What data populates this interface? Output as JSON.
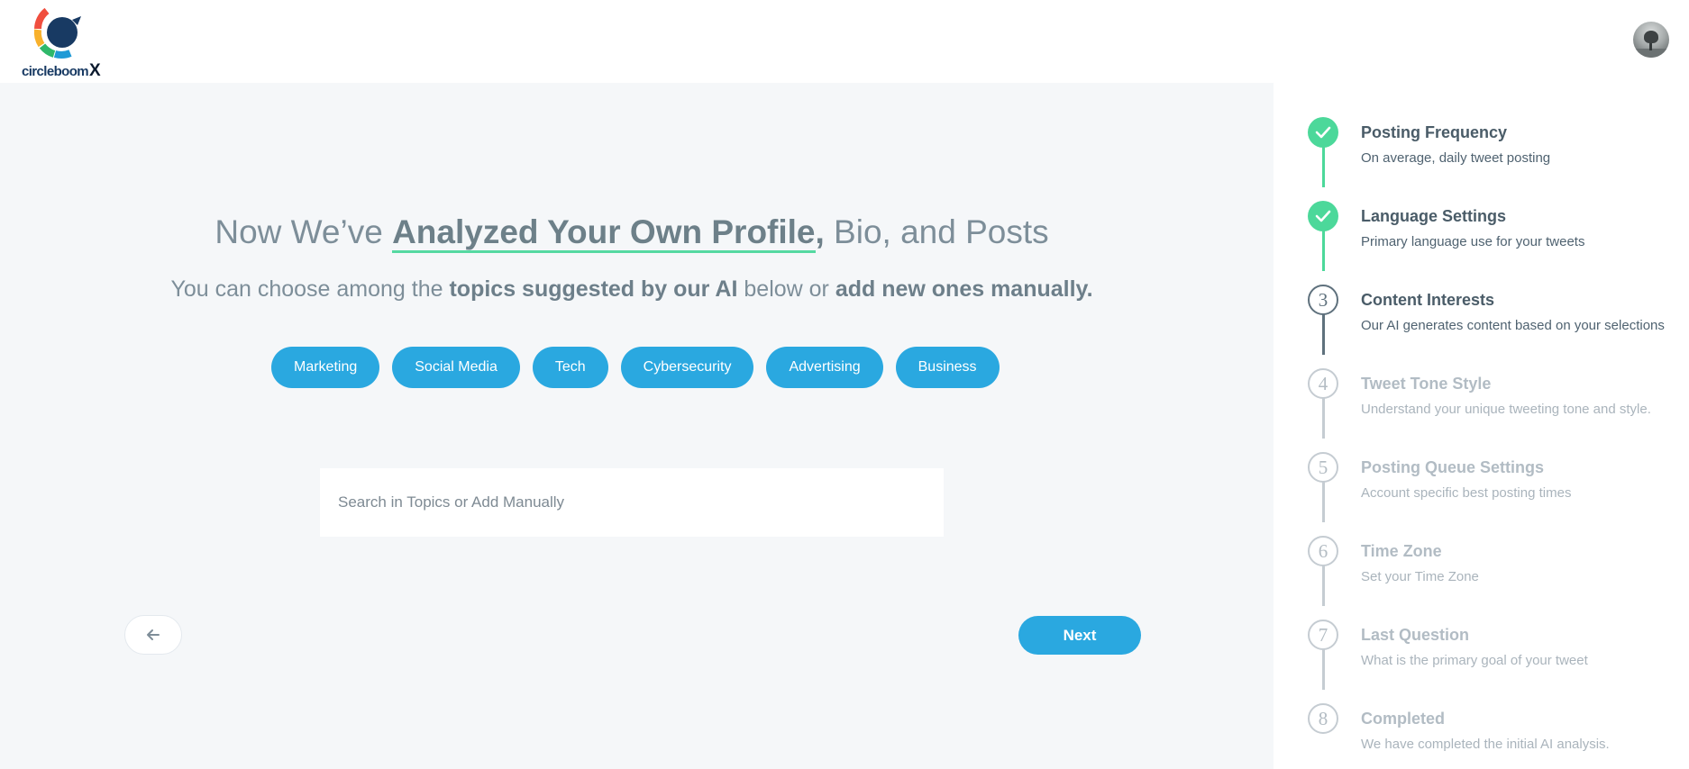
{
  "brand": {
    "logo_text": "circleboom",
    "logo_suffix": "X",
    "colors": {
      "primary": "#2aa8e0",
      "success": "#4cd89a",
      "navy": "#183a63"
    }
  },
  "user": {
    "avatar_icon": "user-avatar"
  },
  "main": {
    "headline_pre": "Now We’ve ",
    "headline_highlight": "Analyzed Your Own Profile",
    "headline_comma": ",",
    "headline_post": " Bio, and Posts",
    "sub_pre": "You can choose among the ",
    "sub_bold1": "topics suggested by our AI",
    "sub_mid": " below or ",
    "sub_bold2": "add new ones manually.",
    "topics": [
      "Marketing",
      "Social Media",
      "Tech",
      "Cybersecurity",
      "Advertising",
      "Business"
    ],
    "search_placeholder": "Search in Topics or Add Manually",
    "back_icon": "arrow-left-icon",
    "next_label": "Next"
  },
  "steps": [
    {
      "number": "1",
      "title": "Posting Frequency",
      "desc": "On average, daily tweet posting",
      "status": "done"
    },
    {
      "number": "2",
      "title": "Language Settings",
      "desc": "Primary language use for your tweets",
      "status": "done"
    },
    {
      "number": "3",
      "title": "Content Interests",
      "desc": "Our AI generates content based on your selections",
      "status": "current"
    },
    {
      "number": "4",
      "title": "Tweet Tone Style",
      "desc": "Understand your unique tweeting tone and style.",
      "status": "pending"
    },
    {
      "number": "5",
      "title": "Posting Queue Settings",
      "desc": "Account specific best posting times",
      "status": "pending"
    },
    {
      "number": "6",
      "title": "Time Zone",
      "desc": "Set your Time Zone",
      "status": "pending"
    },
    {
      "number": "7",
      "title": "Last Question",
      "desc": "What is the primary goal of your tweet",
      "status": "pending"
    },
    {
      "number": "8",
      "title": "Completed",
      "desc": "We have completed the initial AI analysis.",
      "status": "pending"
    }
  ]
}
